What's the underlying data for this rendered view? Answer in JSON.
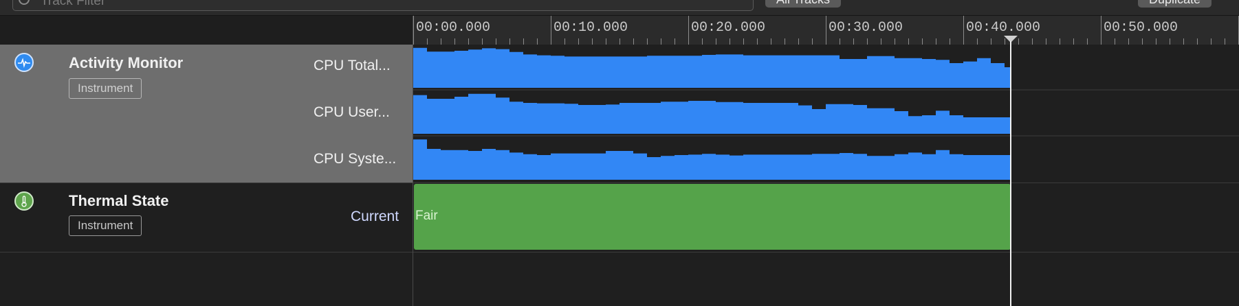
{
  "toolbar": {
    "filter_placeholder": "Track Filter",
    "all_tracks_label": "All Tracks",
    "duplicate_label": "Duplicate"
  },
  "ruler": {
    "labels": [
      "00:00.000",
      "00:10.000",
      "00:20.000",
      "00:30.000",
      "00:40.000",
      "00:50.000"
    ],
    "playhead_time_s": 43.5
  },
  "tracks": [
    {
      "title": "Activity Monitor",
      "badge": "Instrument",
      "icon": "activity-monitor-icon",
      "icon_color": "#2f8bf0",
      "sublabels": [
        "CPU Total...",
        "CPU User...",
        "CPU Syste..."
      ]
    },
    {
      "title": "Thermal State",
      "badge": "Instrument",
      "icon": "thermometer-icon",
      "icon_color": "#5ea44c",
      "sublabels": [
        "Current"
      ],
      "state_label": "Fair",
      "state_color": "#55a34a"
    }
  ],
  "chart_data": {
    "type": "area",
    "x_unit": "s",
    "xlim": [
      0,
      43.5
    ],
    "series_color": "#3287f5",
    "series": [
      {
        "name": "CPU Total...",
        "step_s": 1,
        "values": [
          0.97,
          0.88,
          0.88,
          0.9,
          0.93,
          0.96,
          0.94,
          0.87,
          0.81,
          0.79,
          0.78,
          0.76,
          0.76,
          0.76,
          0.76,
          0.76,
          0.76,
          0.78,
          0.78,
          0.78,
          0.78,
          0.8,
          0.81,
          0.81,
          0.79,
          0.79,
          0.79,
          0.79,
          0.79,
          0.79,
          0.79,
          0.7,
          0.7,
          0.77,
          0.77,
          0.72,
          0.72,
          0.7,
          0.68,
          0.6,
          0.64,
          0.72,
          0.6,
          0.5
        ]
      },
      {
        "name": "CPU User...",
        "step_s": 1,
        "values": [
          0.94,
          0.85,
          0.85,
          0.9,
          0.97,
          0.97,
          0.88,
          0.78,
          0.75,
          0.74,
          0.74,
          0.73,
          0.7,
          0.7,
          0.71,
          0.75,
          0.75,
          0.75,
          0.78,
          0.78,
          0.8,
          0.8,
          0.77,
          0.77,
          0.75,
          0.75,
          0.75,
          0.75,
          0.69,
          0.6,
          0.72,
          0.72,
          0.7,
          0.62,
          0.62,
          0.55,
          0.43,
          0.45,
          0.56,
          0.45,
          0.4,
          0.4,
          0.4,
          0.4
        ]
      },
      {
        "name": "CPU Syste...",
        "step_s": 1,
        "values": [
          0.98,
          0.75,
          0.72,
          0.72,
          0.7,
          0.75,
          0.72,
          0.66,
          0.62,
          0.6,
          0.64,
          0.64,
          0.64,
          0.64,
          0.7,
          0.7,
          0.64,
          0.55,
          0.58,
          0.6,
          0.61,
          0.63,
          0.61,
          0.59,
          0.61,
          0.61,
          0.61,
          0.61,
          0.61,
          0.63,
          0.63,
          0.65,
          0.63,
          0.58,
          0.58,
          0.62,
          0.66,
          0.62,
          0.72,
          0.62,
          0.6,
          0.6,
          0.6,
          0.6
        ]
      }
    ]
  }
}
